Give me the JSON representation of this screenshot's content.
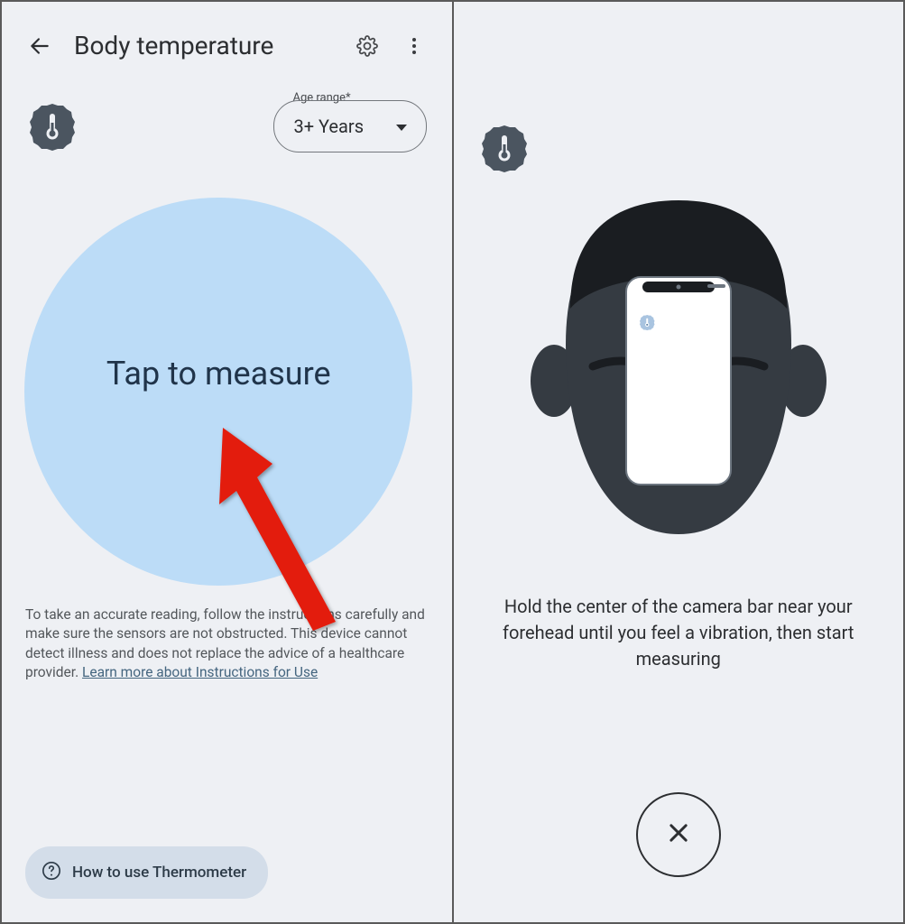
{
  "left": {
    "header": {
      "title": "Body temperature"
    },
    "age": {
      "label": "Age range*",
      "value": "3+ Years"
    },
    "measure": {
      "label": "Tap to measure"
    },
    "disclaimer": {
      "text": "To take an accurate reading, follow the instructions carefully and make sure the sensors are not obstructed. This device cannot detect illness and does not replace the advice of a healthcare provider. ",
      "link": "Learn more about Instructions for Use"
    },
    "howto": {
      "label": "How to use Thermometer"
    }
  },
  "right": {
    "instruction": "Hold the center of the camera bar near your forehead until you feel a vibration, then start measuring"
  }
}
